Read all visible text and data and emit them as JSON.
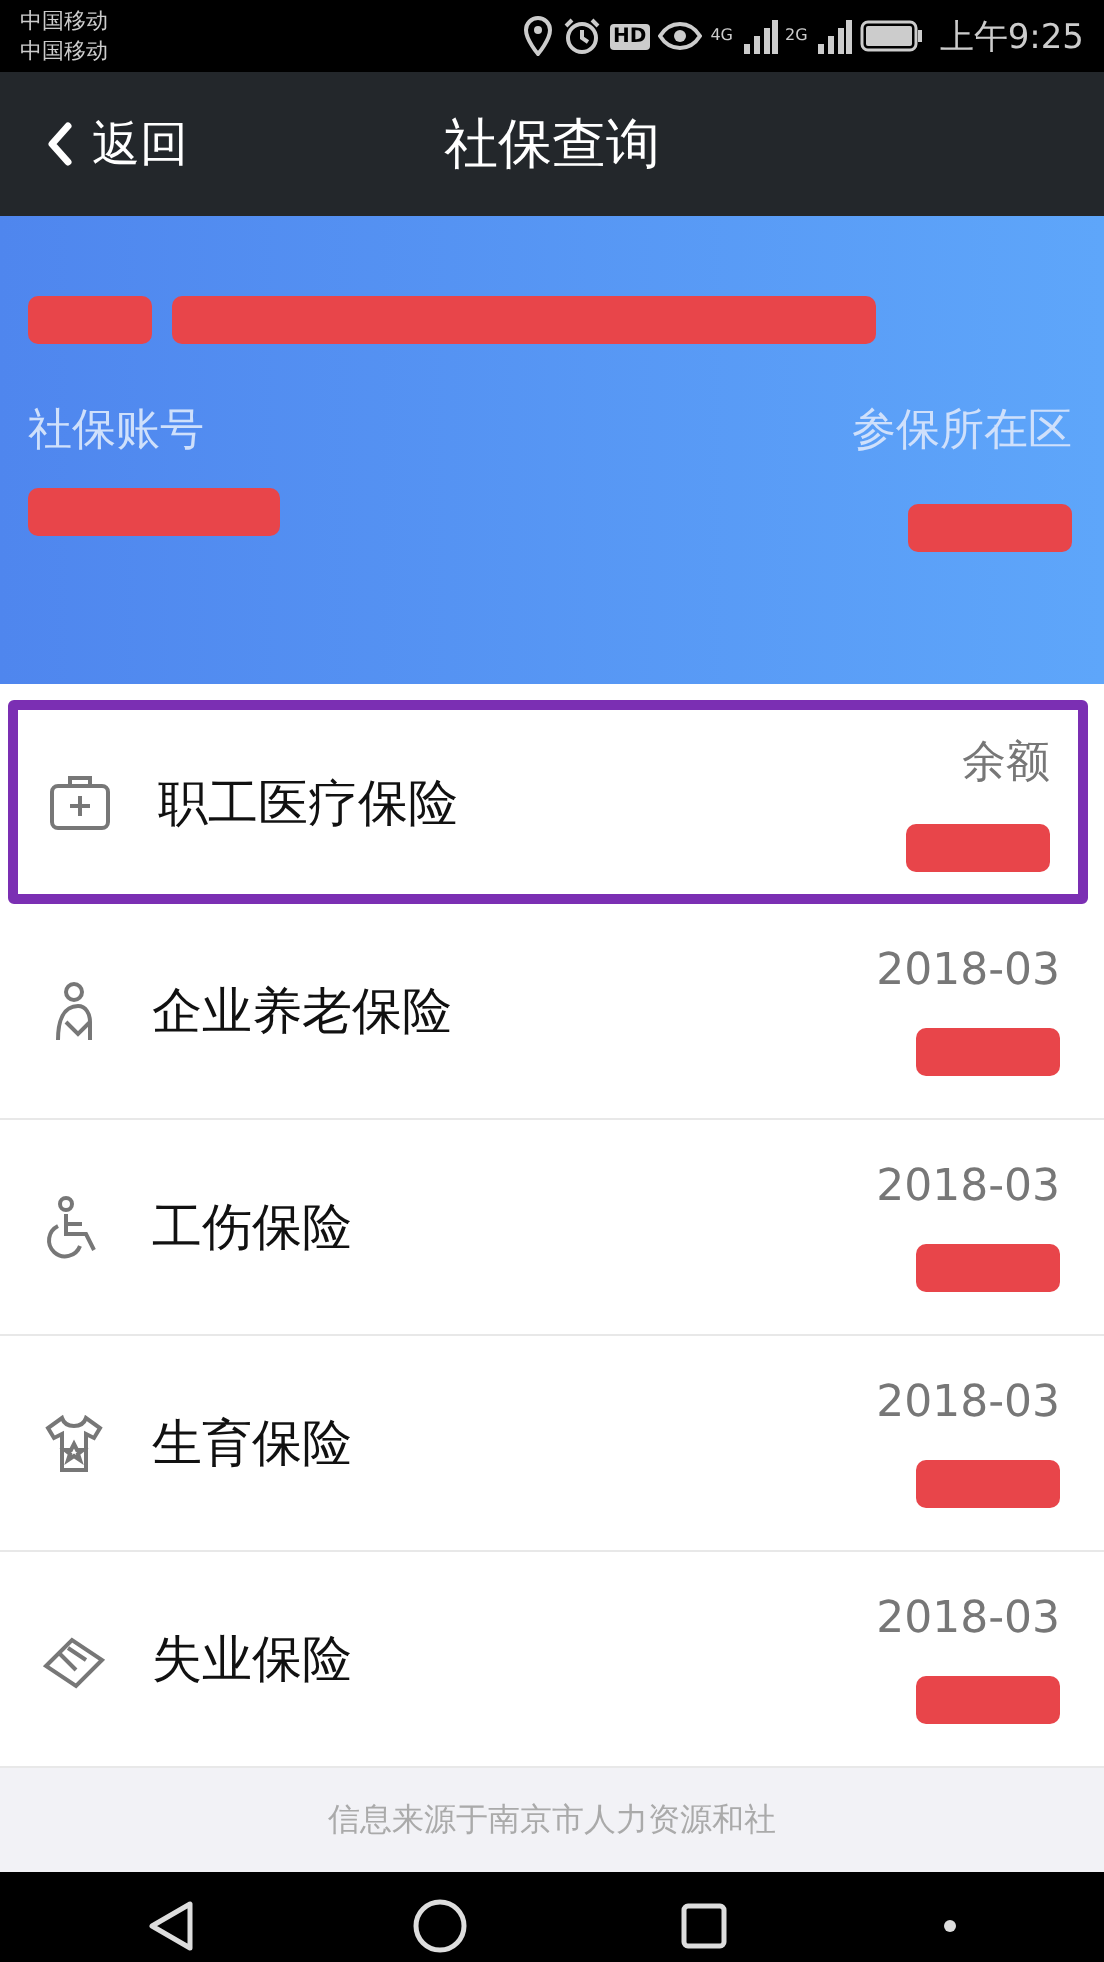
{
  "status_bar": {
    "carriers": [
      "中国移动",
      "中国移动"
    ],
    "hd": "HD",
    "network_1": "4G",
    "network_2": "2G",
    "time": "上午9:25"
  },
  "header": {
    "back": "返回",
    "title": "社保查询"
  },
  "account": {
    "account_label": "社保账号",
    "district_label": "参保所在区"
  },
  "insurances": [
    {
      "kind": "medical",
      "name": "职工医疗保险",
      "date": "余额",
      "highlighted": true
    },
    {
      "kind": "pension",
      "name": "企业养老保险",
      "date": "2018-03",
      "highlighted": false
    },
    {
      "kind": "injury",
      "name": "工伤保险",
      "date": "2018-03",
      "highlighted": false
    },
    {
      "kind": "maternity",
      "name": "生育保险",
      "date": "2018-03",
      "highlighted": false
    },
    {
      "kind": "unemployment",
      "name": "失业保险",
      "date": "2018-03",
      "highlighted": false
    }
  ],
  "footer": "信息来源于南京市人力资源和社"
}
